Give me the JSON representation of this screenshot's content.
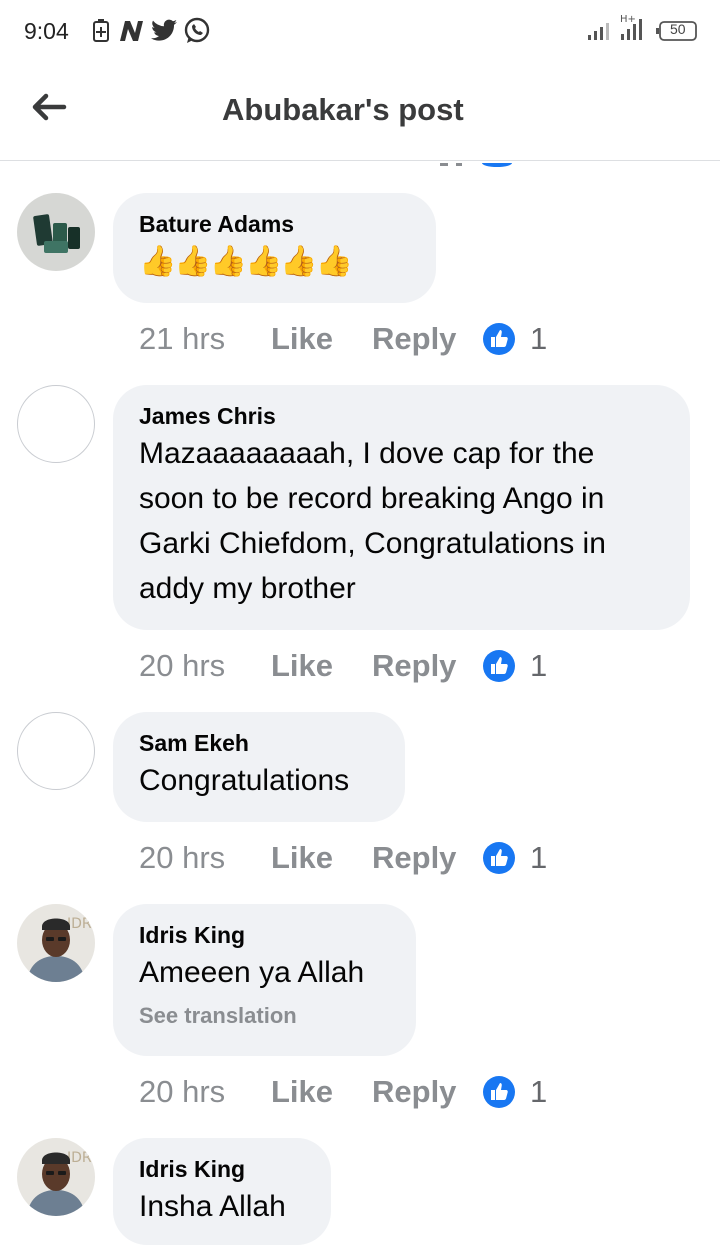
{
  "status_bar": {
    "time": "9:04",
    "battery": "50"
  },
  "header": {
    "title": "Abubakar's post"
  },
  "colors": {
    "like_blue": "#1877f2",
    "bubble": "#f0f2f5",
    "meta_gray": "#8a8d91"
  },
  "comments": [
    {
      "author": "Bature Adams",
      "text": "",
      "emoji": "👍👍👍👍👍👍",
      "time": "21 hrs",
      "like": "Like",
      "reply": "Reply",
      "reactions": "1"
    },
    {
      "author": "James Chris",
      "text_lines": [
        "Mazaaaaaaaah, I dove cap  for the",
        "soon to be record breaking Ango in",
        "Garki Chiefdom, Congratulations in",
        "addy my brother"
      ],
      "time": "20 hrs",
      "like": "Like",
      "reply": "Reply",
      "reactions": "1"
    },
    {
      "author": "Sam Ekeh",
      "text": "Congratulations",
      "time": "20 hrs",
      "like": "Like",
      "reply": "Reply",
      "reactions": "1"
    },
    {
      "author": "Idris King",
      "text": "Ameeen ya Allah",
      "translation": "See translation",
      "time": "20 hrs",
      "like": "Like",
      "reply": "Reply",
      "reactions": "1"
    },
    {
      "author": "Idris King",
      "text": "Insha Allah"
    }
  ]
}
